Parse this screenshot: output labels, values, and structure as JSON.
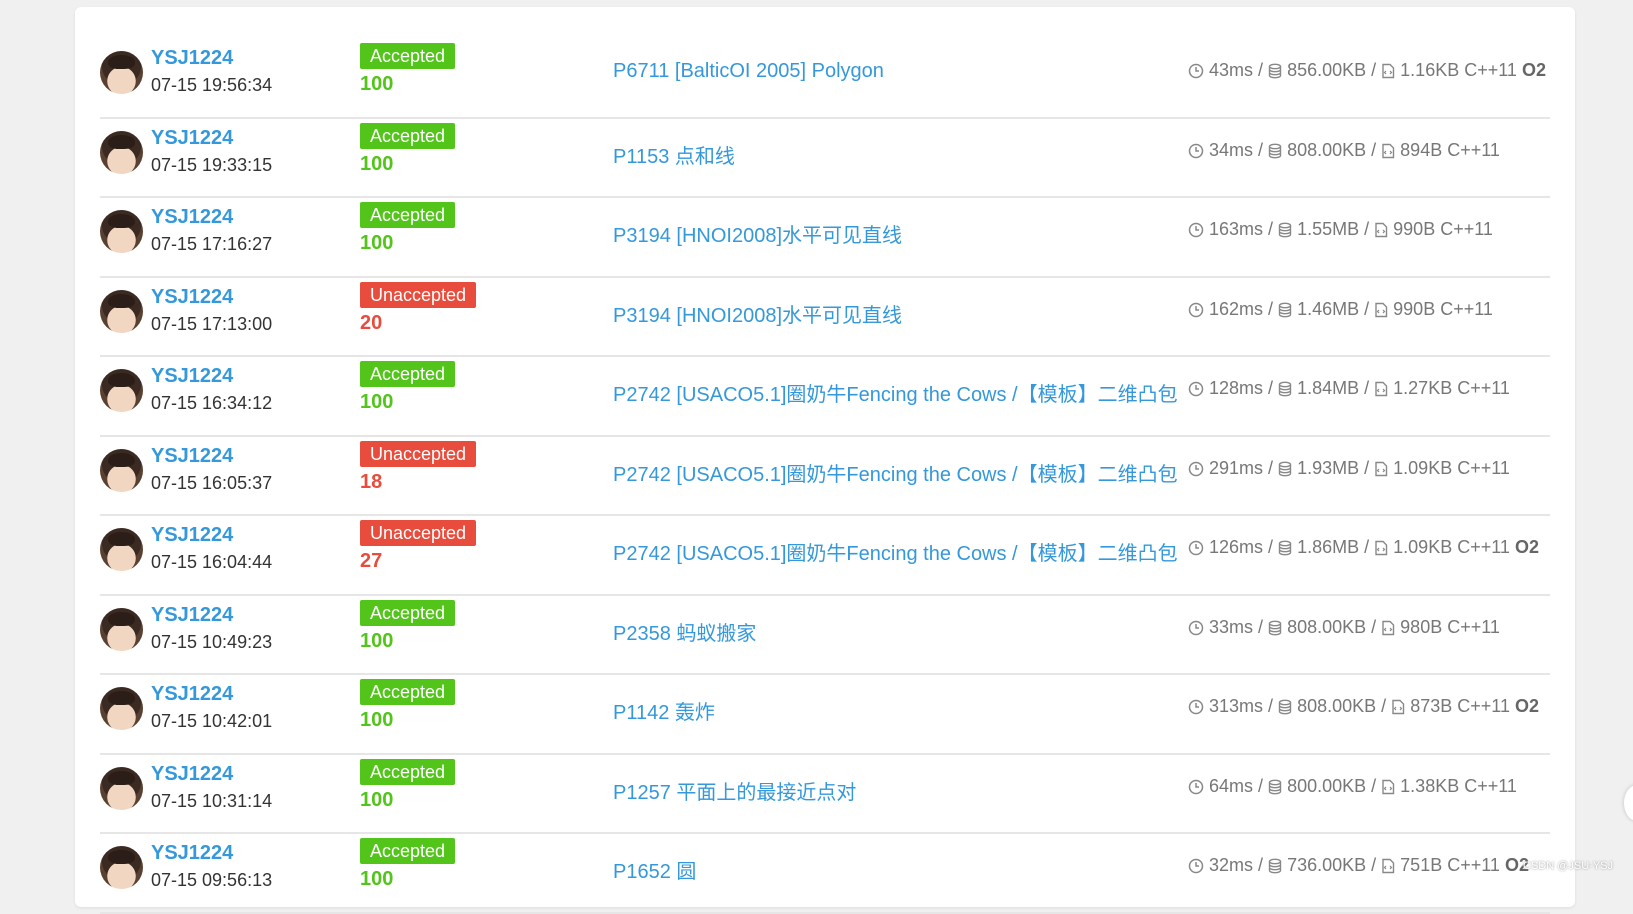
{
  "records": [
    {
      "user": "YSJ1224",
      "time": "07-15 19:56:34",
      "status": "Accepted",
      "score": "100",
      "problem": "P6711 [BalticOI 2005] Polygon",
      "t": "43ms",
      "mem": "856.00KB",
      "code": "1.16KB",
      "lang": "C++11",
      "o2": "O2",
      "ok": true
    },
    {
      "user": "YSJ1224",
      "time": "07-15 19:33:15",
      "status": "Accepted",
      "score": "100",
      "problem": "P1153 点和线",
      "t": "34ms",
      "mem": "808.00KB",
      "code": "894B",
      "lang": "C++11",
      "o2": "",
      "ok": true
    },
    {
      "user": "YSJ1224",
      "time": "07-15 17:16:27",
      "status": "Accepted",
      "score": "100",
      "problem": "P3194 [HNOI2008]水平可见直线",
      "t": "163ms",
      "mem": "1.55MB",
      "code": "990B",
      "lang": "C++11",
      "o2": "",
      "ok": true
    },
    {
      "user": "YSJ1224",
      "time": "07-15 17:13:00",
      "status": "Unaccepted",
      "score": "20",
      "problem": "P3194 [HNOI2008]水平可见直线",
      "t": "162ms",
      "mem": "1.46MB",
      "code": "990B",
      "lang": "C++11",
      "o2": "",
      "ok": false
    },
    {
      "user": "YSJ1224",
      "time": "07-15 16:34:12",
      "status": "Accepted",
      "score": "100",
      "problem": "P2742 [USACO5.1]圈奶牛Fencing the Cows /【模板】二维凸包",
      "t": "128ms",
      "mem": "1.84MB",
      "code": "1.27KB",
      "lang": "C++11",
      "o2": "",
      "ok": true
    },
    {
      "user": "YSJ1224",
      "time": "07-15 16:05:37",
      "status": "Unaccepted",
      "score": "18",
      "problem": "P2742 [USACO5.1]圈奶牛Fencing the Cows /【模板】二维凸包",
      "t": "291ms",
      "mem": "1.93MB",
      "code": "1.09KB",
      "lang": "C++11",
      "o2": "",
      "ok": false
    },
    {
      "user": "YSJ1224",
      "time": "07-15 16:04:44",
      "status": "Unaccepted",
      "score": "27",
      "problem": "P2742 [USACO5.1]圈奶牛Fencing the Cows /【模板】二维凸包",
      "t": "126ms",
      "mem": "1.86MB",
      "code": "1.09KB",
      "lang": "C++11",
      "o2": "O2",
      "ok": false
    },
    {
      "user": "YSJ1224",
      "time": "07-15 10:49:23",
      "status": "Accepted",
      "score": "100",
      "problem": "P2358 蚂蚁搬家",
      "t": "33ms",
      "mem": "808.00KB",
      "code": "980B",
      "lang": "C++11",
      "o2": "",
      "ok": true
    },
    {
      "user": "YSJ1224",
      "time": "07-15 10:42:01",
      "status": "Accepted",
      "score": "100",
      "problem": "P1142 轰炸",
      "t": "313ms",
      "mem": "808.00KB",
      "code": "873B",
      "lang": "C++11",
      "o2": "O2",
      "ok": true
    },
    {
      "user": "YSJ1224",
      "time": "07-15 10:31:14",
      "status": "Accepted",
      "score": "100",
      "problem": "P1257 平面上的最接近点对",
      "t": "64ms",
      "mem": "800.00KB",
      "code": "1.38KB",
      "lang": "C++11",
      "o2": "",
      "ok": true
    },
    {
      "user": "YSJ1224",
      "time": "07-15 09:56:13",
      "status": "Accepted",
      "score": "100",
      "problem": "P1652 圆",
      "t": "32ms",
      "mem": "736.00KB",
      "code": "751B",
      "lang": "C++11",
      "o2": "O2",
      "ok": true
    }
  ],
  "watermark": "CSDN @JSU-YSJ",
  "colors": {
    "accent": "#3498db",
    "accepted": "#52c41a",
    "unaccepted": "#e74c3c"
  }
}
